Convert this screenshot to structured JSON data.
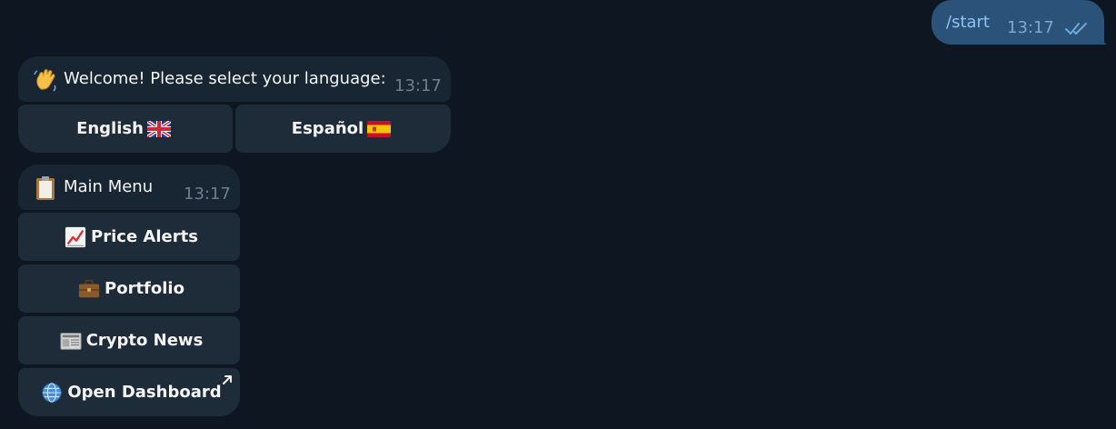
{
  "outgoing": {
    "text": "/start",
    "time": "13:17",
    "status_icon": "double-check-icon",
    "colors": {
      "bubble": "#2b5278",
      "text": "#8ec3f5"
    }
  },
  "language_prompt": {
    "emoji": "waving-hand-icon",
    "text": "Welcome! Please select your language:",
    "time": "13:17",
    "buttons": [
      {
        "label": "English",
        "flag": "uk-flag-icon"
      },
      {
        "label": "Español",
        "flag": "spain-flag-icon"
      }
    ]
  },
  "main_menu": {
    "emoji": "clipboard-icon",
    "text": "Main Menu",
    "time": "13:17",
    "buttons": [
      {
        "label": "Price Alerts",
        "icon": "chart-increasing-icon"
      },
      {
        "label": "Portfolio",
        "icon": "briefcase-icon"
      },
      {
        "label": "Crypto News",
        "icon": "newspaper-icon"
      },
      {
        "label": "Open Dashboard",
        "icon": "globe-icon",
        "external": true
      }
    ]
  },
  "colors": {
    "background": "#0e1621",
    "incoming_bubble": "#182533",
    "button": "#1e2c3a",
    "time_text": "#6d7f8f"
  }
}
